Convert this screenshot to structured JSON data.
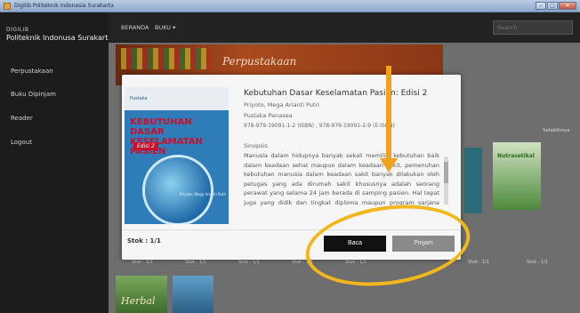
{
  "window": {
    "title": "Digilib Politeknik Indonesia Surakarta"
  },
  "brand": {
    "line1": "DIGILIB",
    "line2": "Politeknik Indonusa Surakarta"
  },
  "sidebar": {
    "items": [
      {
        "label": "Perpustakaan"
      },
      {
        "label": "Buku Dipinjam"
      },
      {
        "label": "Reader"
      },
      {
        "label": "Logout"
      }
    ]
  },
  "topnav": {
    "menu": [
      {
        "label": "BERANDA"
      },
      {
        "label": "BUKU ▾"
      }
    ],
    "search_placeholder": "Search"
  },
  "banner": {
    "text": "Perpustakaan"
  },
  "main": {
    "selengkapnya": "Selebihnya",
    "stok_labels": [
      "Stok : 1/1",
      "Stok : 1/1",
      "Stok : 1/1",
      "Stok : 1/1",
      "Stok : 1/1",
      "Stok : 1/1",
      "Stok : 1/1"
    ],
    "side_book_title": "Nutrasetikal",
    "herbal_title": "Herbal"
  },
  "modal": {
    "cover": {
      "logo": "Pustaka",
      "title_line1": "KEBUTUHAN DASAR",
      "title_line2": "KESELAMATAN PASIEN",
      "edition": "Edisi 2",
      "authors": "Priyoto, Mega Arianti Putri"
    },
    "title": "Kebutuhan Dasar Keselamatan Pasien: Edisi 2",
    "authors": "Priyoto, Mega Arianti Putri",
    "publisher": "Pustaka Panasea",
    "isbn": "978-979-19091-1-2 (ISBN) , 978-979-19091-2-9 (E-ISBN)",
    "sinopsis_label": "Sinopsis",
    "sinopsis": "Manusia dalam hidupnya banyak sekali memiliki kebutuhan baik dalam keadaan sehat maupun dalam keadaan sakit, pemenuhan kebutuhan manusia dalam keadaan sakit banyak dilakukan oleh petugas yang ada dirumah sakit khususnya adalah seorang perawat yang selama 24 jam berada di samping pasien. Hal tepat juga yang didik dan tingkat diploma maupun program sarjana yang lagi.",
    "stok": "Stok : 1/1",
    "btn_baca": "Baca",
    "btn_pinjam": "Pinjam"
  },
  "colors": {
    "accent_annotation": "#f2b71c",
    "btn_primary": "#111111",
    "btn_secondary": "#8a8a8a"
  }
}
